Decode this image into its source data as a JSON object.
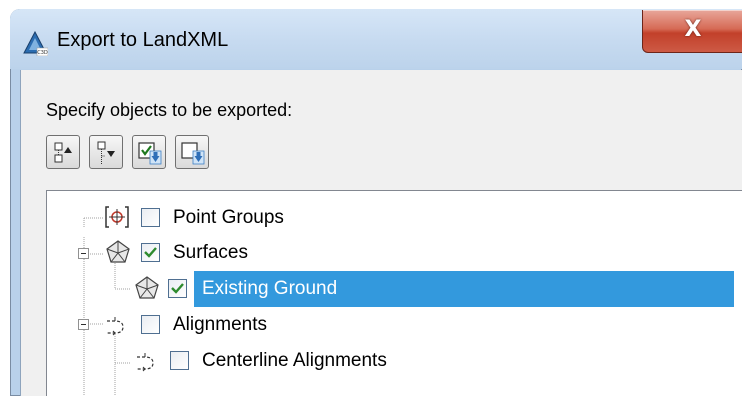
{
  "window": {
    "title": "Export to LandXML",
    "close_glyph": "X"
  },
  "instruction": "Specify objects to be exported:",
  "toolbar": {
    "buttons": [
      {
        "icon": "collapse-tree-icon"
      },
      {
        "icon": "expand-tree-icon"
      },
      {
        "icon": "check-all-icon"
      },
      {
        "icon": "uncheck-all-icon"
      }
    ]
  },
  "tree": {
    "items": [
      {
        "label": "Point Groups",
        "checked": false,
        "icon": "point-groups-icon",
        "expanded": false
      },
      {
        "label": "Surfaces",
        "checked": true,
        "icon": "surface-icon",
        "expanded": true
      },
      {
        "label": "Existing Ground",
        "checked": true,
        "icon": "surface-icon",
        "selected": true
      },
      {
        "label": "Alignments",
        "checked": false,
        "icon": "alignment-icon",
        "expanded": true
      },
      {
        "label": "Centerline Alignments",
        "checked": false,
        "icon": "alignment-icon"
      }
    ]
  },
  "colors": {
    "selection": "#3399dd",
    "check": "#2e8b2e",
    "titlebar": "#c6daf0",
    "close": "#c2402a"
  }
}
